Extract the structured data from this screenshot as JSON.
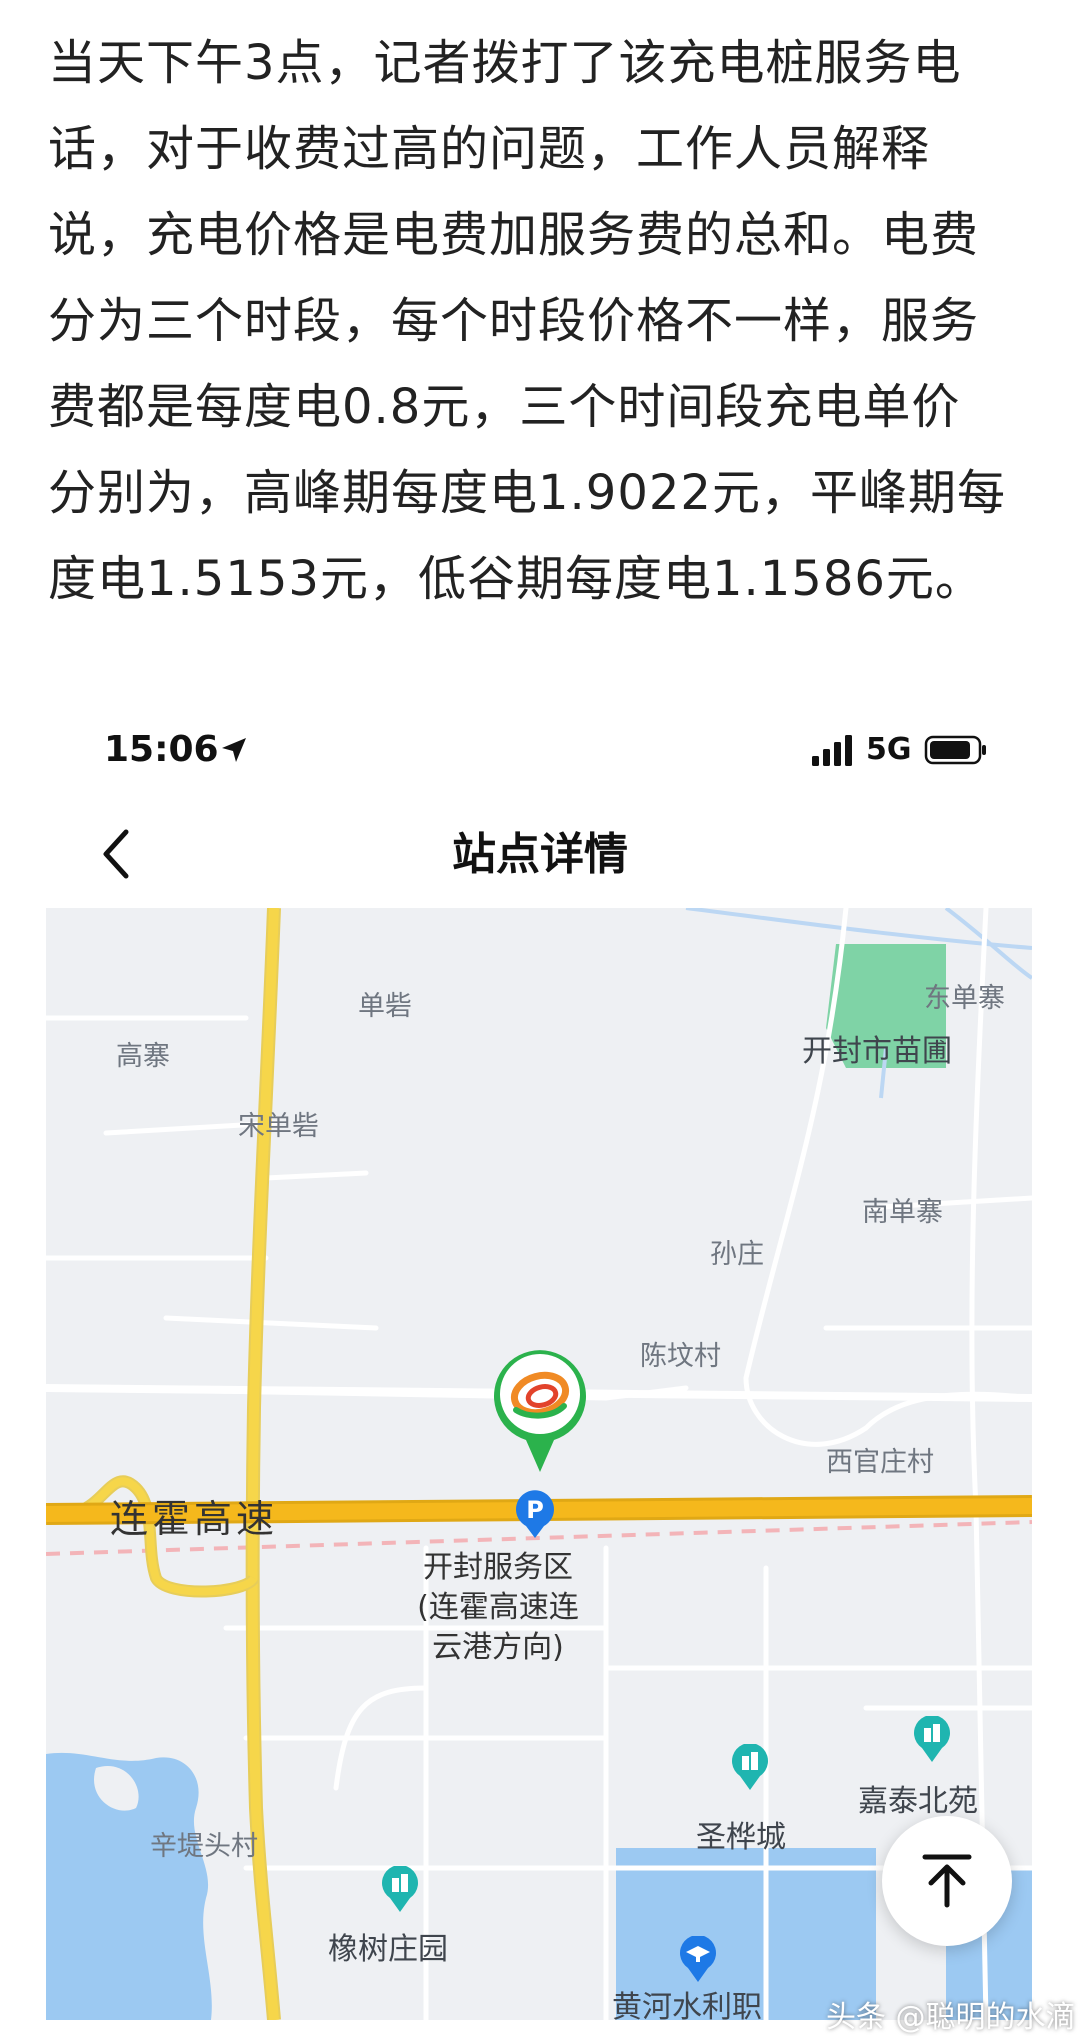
{
  "article": {
    "lines": [
      "当天下午3点，记者拨打了该充电桩服务电",
      "话，对于收费过高的问题，工作人员解释",
      "说，充电价格是电费加服务费的总和。电费",
      "分为三个时段，每个时段价格不一样，服务",
      "费都是每度电0.8元，三个时间段充电单价",
      "分别为，高峰期每度电1.9022元，平峰期每",
      "度电1.5153元，低谷期每度电1.1586元。"
    ]
  },
  "status_bar": {
    "time": "15:06",
    "network": "5G",
    "icons": [
      "location-arrow-icon",
      "signal-icon",
      "battery-icon"
    ]
  },
  "nav": {
    "title": "站点详情",
    "back_icon": "chevron-left-icon"
  },
  "map": {
    "places": {
      "shanjie": "单砦",
      "gaozhai": "高寨",
      "songshanjie": "宋单砦",
      "dongshanzhai": "东单寨",
      "nursery": "开封市苗圃",
      "nanshanzhai": "南单寨",
      "sunzhuang": "孙庄",
      "chenpo": "陈坟村",
      "xiguanzhuang": "西官庄村",
      "jiatai": "嘉泰北苑",
      "shenghua": "圣桦城",
      "xindi": "辛堤头村",
      "xiangshu": "橡树庄园",
      "huanghe": "黄河水利职"
    },
    "road": "连霍高速",
    "service_area": [
      "开封服务区",
      "(连霍高速连",
      "云港方向)"
    ]
  },
  "floating_button": {
    "icon": "back-to-top-icon"
  },
  "watermark": "头条 @聪明的水滴",
  "colors": {
    "highway": "#f5b81c",
    "main_road": "#f6d64a",
    "park": "#7fd3a6",
    "water": "#9cc9f2",
    "poi_teal": "#1fb5b0",
    "pin_green": "#2bb24c",
    "parking_blue": "#1e79e6"
  }
}
